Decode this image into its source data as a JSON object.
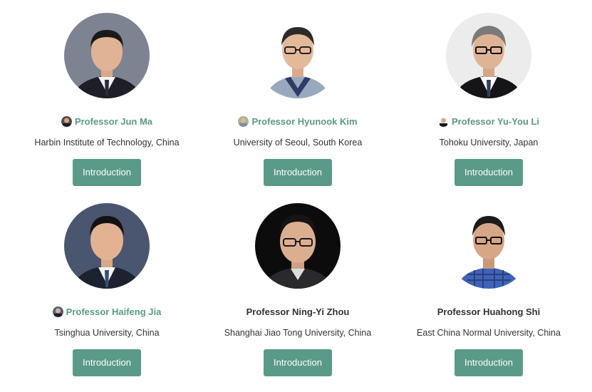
{
  "speakers": [
    {
      "name": "Professor Jun Ma",
      "affiliation": "Harbin Institute of Technology, China",
      "button": "Introduction",
      "has_icon": true
    },
    {
      "name": "Professor Hyunook Kim",
      "affiliation": "University of Seoul, South Korea",
      "button": "Introduction",
      "has_icon": true
    },
    {
      "name": "Professor Yu-You Li",
      "affiliation": "Tohoku University, Japan",
      "button": "Introduction",
      "has_icon": true
    },
    {
      "name": "Professor Haifeng Jia",
      "affiliation": "Tsinghua University, China",
      "button": "Introduction",
      "has_icon": true
    },
    {
      "name": "Professor Ning-Yi Zhou",
      "affiliation": "Shanghai Jiao Tong University, China",
      "button": "Introduction",
      "has_icon": false
    },
    {
      "name": "Professor Huahong Shi",
      "affiliation": "East China Normal University, China",
      "button": "Introduction",
      "has_icon": false
    }
  ],
  "colors": {
    "accent": "#5a9a88",
    "link_text": "#5b9a87",
    "body_text": "#333333"
  }
}
